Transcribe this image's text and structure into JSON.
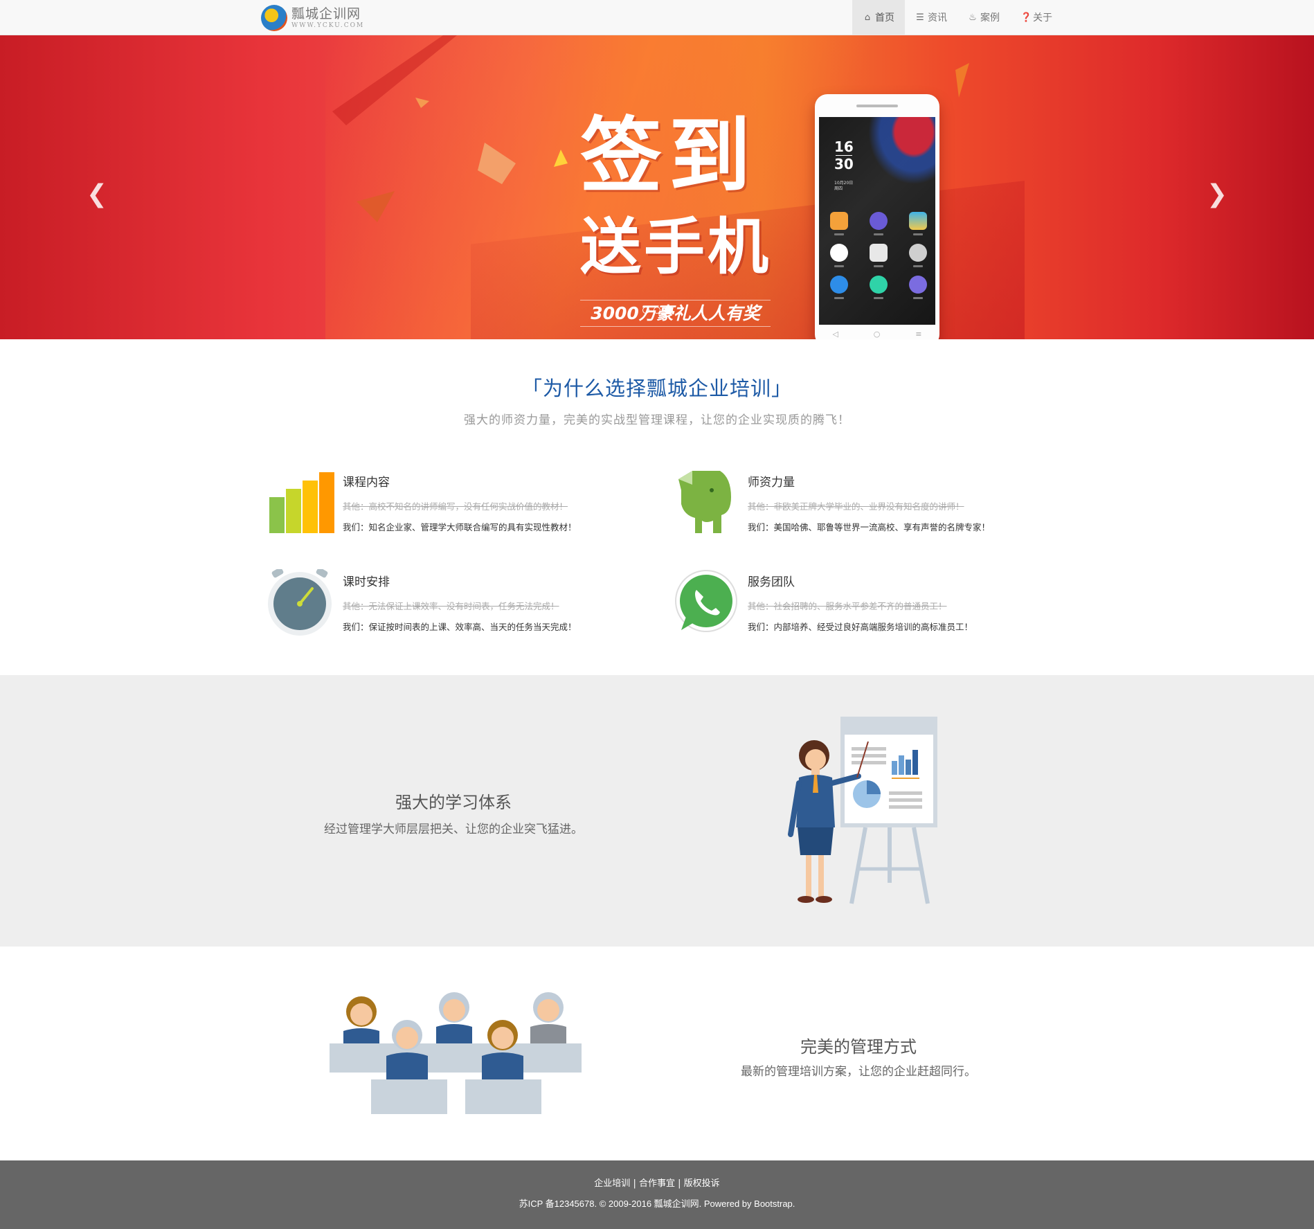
{
  "navbar": {
    "brand_title": "瓢城企训网",
    "brand_sub": "WWW.YCKU.COM",
    "items": [
      {
        "label": "首页",
        "icon": "home-icon",
        "active": true
      },
      {
        "label": "资讯",
        "icon": "list-icon",
        "active": false
      },
      {
        "label": "案例",
        "icon": "fire-icon",
        "active": false
      },
      {
        "label": "关于",
        "icon": "question-circle-icon",
        "active": false
      }
    ]
  },
  "carousel": {
    "headline": "签到",
    "subheadline": "送手机",
    "tagline": "3000万豪礼人人有奖",
    "phone_time_hour": "16",
    "phone_time_minute": "30",
    "phone_date_line1": "10月20日",
    "phone_date_line2": "周四",
    "slide_count": 3,
    "active_slide": 3,
    "prev_icon": "chevron-left-icon",
    "next_icon": "chevron-right-icon"
  },
  "why": {
    "title": "「为什么选择瓢城企业培训」",
    "subtitle": "强大的师资力量，完美的实战型管理课程，让您的企业实现质的腾飞！",
    "features": [
      {
        "title": "课程内容",
        "old": "其他：高校不知名的讲师编写，没有任何实战价值的教材！",
        "new": "我们：知名企业家、管理学大师联合编写的具有实现性教材！",
        "icon": "bar-chart-icon"
      },
      {
        "title": "师资力量",
        "old": "其他：非欧美正牌大学毕业的、业界没有知名度的讲师！",
        "new": "我们：美国哈佛、耶鲁等世界一流高校、享有声誉的名牌专家！",
        "icon": "elephant-icon"
      },
      {
        "title": "课时安排",
        "old": "其他：无法保证上课效率、没有时间表，任务无法完成！",
        "new": "我们：保证按时间表的上课、效率高、当天的任务当天完成！",
        "icon": "stopwatch-icon"
      },
      {
        "title": "服务团队",
        "old": "其他：社会招聘的、服务水平参差不齐的普通员工！",
        "new": "我们：内部培养、经受过良好高端服务培训的高标准员工！",
        "icon": "phone-chat-icon"
      }
    ]
  },
  "learn": {
    "title": "强大的学习体系",
    "subtitle": "经过管理学大师层层把关、让您的企业突飞猛进。",
    "illustration": "presenter-illustration"
  },
  "manage": {
    "title": "完美的管理方式",
    "subtitle": "最新的管理培训方案，让您的企业赶超同行。",
    "illustration": "support-team-illustration"
  },
  "footer": {
    "links": [
      "企业培训",
      "合作事宜",
      "版权投诉"
    ],
    "separator": "|",
    "copyright": "苏ICP 备12345678. © 2009-2016 瓢城企训网. Powered by Bootstrap."
  }
}
